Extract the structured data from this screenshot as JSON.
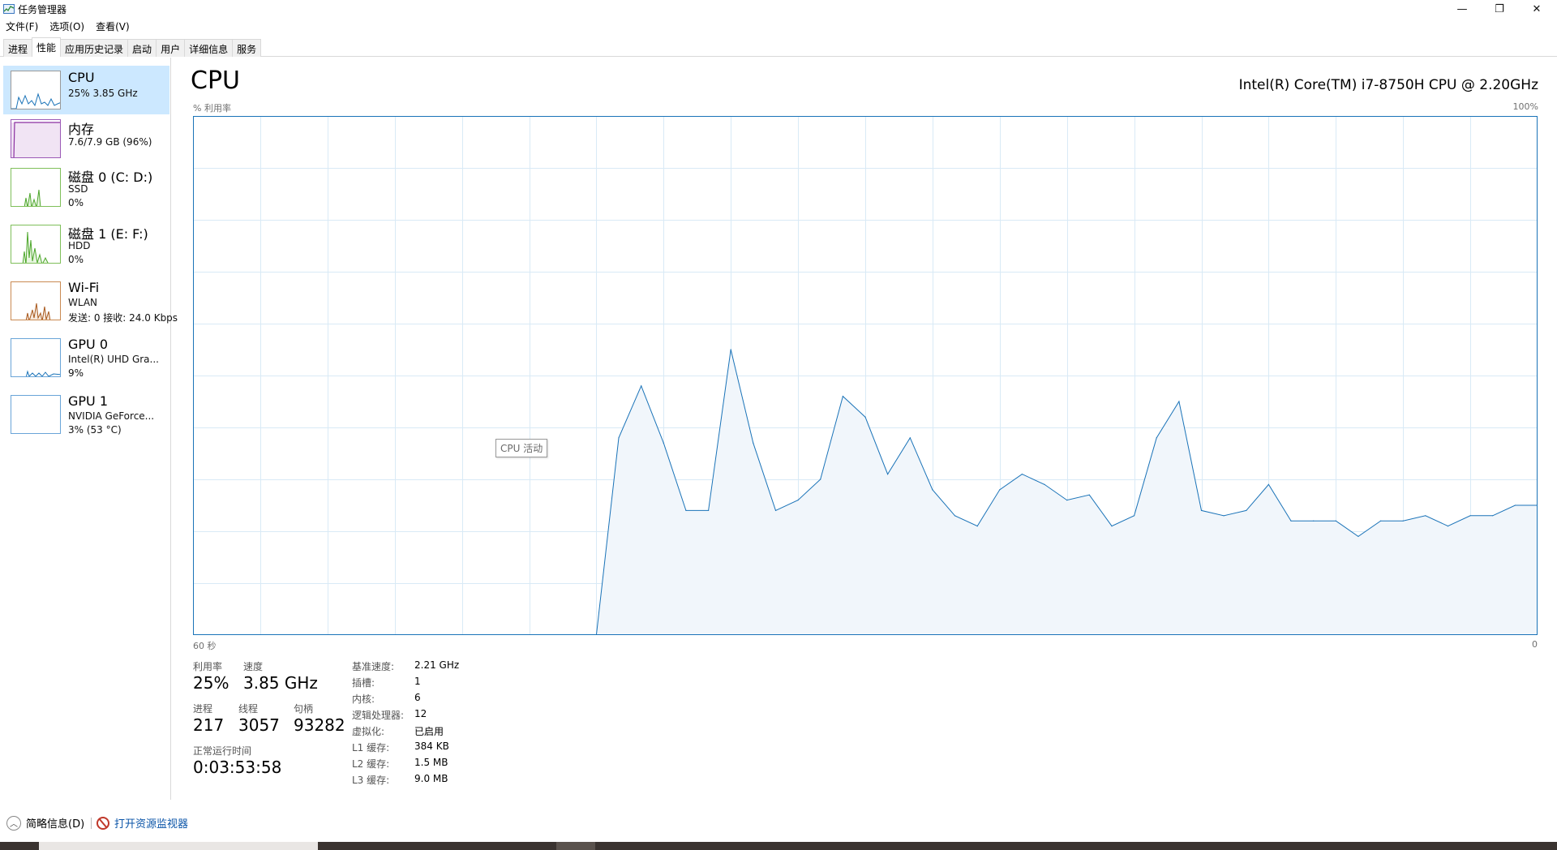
{
  "window": {
    "title": "任务管理器",
    "icon": "task-manager-icon",
    "controls": {
      "minimize": "—",
      "maximize": "❐",
      "close": "✕"
    }
  },
  "menu": [
    "文件(F)",
    "选项(O)",
    "查看(V)"
  ],
  "tabs": [
    {
      "label": "进程",
      "active": false
    },
    {
      "label": "性能",
      "active": true
    },
    {
      "label": "应用历史记录",
      "active": false
    },
    {
      "label": "启动",
      "active": false
    },
    {
      "label": "用户",
      "active": false
    },
    {
      "label": "详细信息",
      "active": false
    },
    {
      "label": "服务",
      "active": false
    }
  ],
  "sidebar": [
    {
      "title": "CPU",
      "lines": [
        "25% 3.85 GHz"
      ],
      "color": "#1a73b8",
      "selected": true
    },
    {
      "title": "内存",
      "lines": [
        "7.6/7.9 GB (96%)"
      ],
      "color": "#8b2fa0",
      "selected": false
    },
    {
      "title": "磁盘 0 (C: D:)",
      "lines": [
        "SSD",
        "0%"
      ],
      "color": "#4ca62a",
      "selected": false
    },
    {
      "title": "磁盘 1 (E: F:)",
      "lines": [
        "HDD",
        "0%"
      ],
      "color": "#4ca62a",
      "selected": false
    },
    {
      "title": "Wi-Fi",
      "lines": [
        "WLAN",
        "发送: 0 接收: 24.0 Kbps"
      ],
      "color": "#a7571b",
      "selected": false
    },
    {
      "title": "GPU 0",
      "lines": [
        "Intel(R) UHD Gra...",
        "9%"
      ],
      "color": "#1a73b8",
      "selected": false
    },
    {
      "title": "GPU 1",
      "lines": [
        "NVIDIA GeForce...",
        "3% (53 °C)"
      ],
      "color": "#1a73b8",
      "selected": false
    }
  ],
  "main": {
    "heading": "CPU",
    "model": "Intel(R) Core(TM) i7-8750H CPU @ 2.20GHz",
    "y_axis_label": "% 利用率",
    "y_max_label": "100%",
    "x_left_label": "60 秒",
    "x_right_label": "0",
    "tooltip": "CPU 活动",
    "accent": "#1a73b8"
  },
  "stats": {
    "utilization_label": "利用率",
    "utilization": "25%",
    "speed_label": "速度",
    "speed": "3.85 GHz",
    "processes_label": "进程",
    "processes": "217",
    "threads_label": "线程",
    "threads": "3057",
    "handles_label": "句柄",
    "handles": "93282",
    "uptime_label": "正常运行时间",
    "uptime": "0:03:53:58"
  },
  "specs": [
    {
      "label": "基准速度:",
      "value": "2.21 GHz"
    },
    {
      "label": "插槽:",
      "value": "1"
    },
    {
      "label": "内核:",
      "value": "6"
    },
    {
      "label": "逻辑处理器:",
      "value": "12"
    },
    {
      "label": "虚拟化:",
      "value": "已启用"
    },
    {
      "label": "L1 缓存:",
      "value": "384 KB"
    },
    {
      "label": "L2 缓存:",
      "value": "1.5 MB"
    },
    {
      "label": "L3 缓存:",
      "value": "9.0 MB"
    }
  ],
  "footer": {
    "summary_label": "简略信息(D)",
    "summary_icon": "chevron-up-icon",
    "resource_monitor_label": "打开资源监视器",
    "resource_monitor_icon": "resource-monitor-icon"
  },
  "chart_data": {
    "type": "area",
    "y_unit": "% 利用率",
    "ylim": [
      0,
      100
    ],
    "x": [
      60,
      59,
      58,
      57,
      56,
      55,
      54,
      53,
      52,
      51,
      50,
      49,
      48,
      47,
      46,
      45,
      44,
      43,
      42,
      41,
      40,
      39,
      38,
      37,
      36,
      35,
      34,
      33,
      32,
      31,
      30,
      29,
      28,
      27,
      26,
      25,
      24,
      23,
      22,
      21,
      20,
      19,
      18,
      17,
      16,
      15,
      14,
      13,
      12,
      11,
      10,
      9,
      8,
      7,
      6,
      5,
      4,
      3,
      2,
      1,
      0
    ],
    "series": [
      {
        "values": [
          0,
          0,
          0,
          0,
          0,
          0,
          0,
          0,
          0,
          0,
          0,
          0,
          0,
          0,
          0,
          0,
          0,
          0,
          0,
          38,
          48,
          37,
          24,
          24,
          55,
          37,
          24,
          26,
          30,
          46,
          42,
          31,
          38,
          28,
          23,
          21,
          28,
          31,
          29,
          26,
          27,
          21,
          23,
          38,
          45,
          24,
          23,
          24,
          29,
          22,
          22,
          22,
          19,
          22,
          22,
          23,
          21,
          23,
          23,
          25,
          25
        ]
      }
    ],
    "grid": true,
    "grid_cols": 20,
    "grid_rows": 10
  }
}
